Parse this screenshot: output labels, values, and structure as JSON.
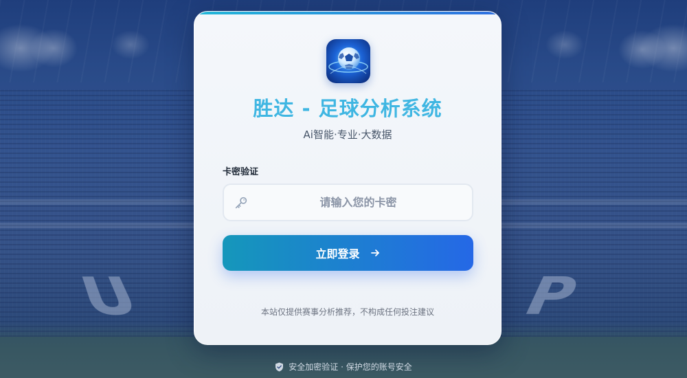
{
  "app": {
    "title": "胜达 - 足球分析系统",
    "subtitle": "Ai智能·专业·大数据",
    "logo_icon": "soccer-ball-icon"
  },
  "login": {
    "field_label": "卡密验证",
    "card_input": {
      "placeholder": "请输入您的卡密",
      "value": "",
      "icon": "key-icon"
    },
    "submit_label": "立即登录",
    "submit_icon": "arrow-right-icon",
    "disclaimer": "本站仅提供赛事分析推荐，不构成任何投注建议"
  },
  "footer": {
    "icon": "shield-check-icon",
    "text": "安全加密验证 · 保护您的账号安全"
  },
  "colors": {
    "title": "#3fb6e2",
    "button_gradient_start": "#1597bb",
    "button_gradient_end": "#2568e6",
    "card_background": "#f4f7fb"
  }
}
